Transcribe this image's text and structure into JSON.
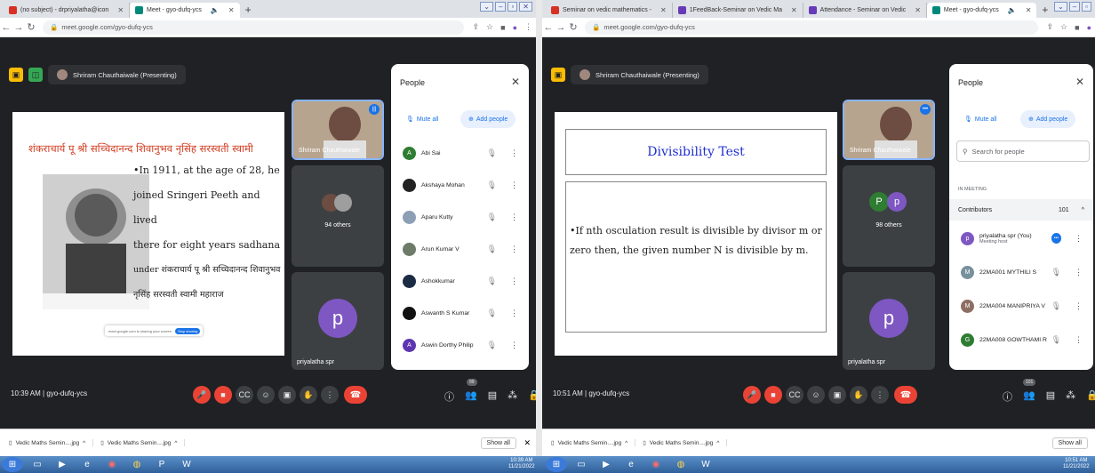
{
  "left": {
    "tabs": [
      {
        "label": "(no subject) - drpriyalatha@icon",
        "color": "#d93025"
      },
      {
        "label": "Meet - gyo-dufq-ycs",
        "color": "#00897b",
        "active": true
      }
    ],
    "url": "meet.google.com/gyo-dufq-ycs",
    "presenter": "Shriram Chauthaiwale (Presenting)",
    "slide": {
      "title": "शंकराचार्य पू श्री सच्चिदानन्द शिवानुभव नृसिंह सरस्वती स्वामी",
      "lines": [
        "•In 1911, at the age of 28, he",
        "joined Sringeri Peeth and lived",
        "there for eight years sadhana",
        "under शंकराचार्य पू श्री सच्चिदानन्द शिवानुभव",
        "नृसिंह सरस्वती स्वामी महाराज"
      ],
      "photo_bar": "meet.google.com is sharing your screen"
    },
    "tiles": {
      "speaker": "Shriram Chauthaiwale",
      "others": "94 others",
      "me": "priyalatha spr",
      "me_initial": "p"
    },
    "panel": {
      "title": "People",
      "mute_all": "Mute all",
      "add_people": "Add people",
      "people": [
        {
          "name": "Abi Sai",
          "initial": "A",
          "color": "#2e7d32"
        },
        {
          "name": "Akshaya Mohan",
          "initial": "",
          "color": "#222222"
        },
        {
          "name": "Aparu Kutty",
          "initial": "",
          "color": "#8d9fb5"
        },
        {
          "name": "Arun Kumar V",
          "initial": "",
          "color": "#6d7b68"
        },
        {
          "name": "Ashokkumar",
          "initial": "",
          "color": "#1c2b44"
        },
        {
          "name": "Aswanth S Kumar",
          "initial": "",
          "color": "#111111"
        },
        {
          "name": "Aswin Dorthy Philip",
          "initial": "A",
          "color": "#5e35b1"
        }
      ]
    },
    "time_code": "10:39 AM | gyo-dufq-ycs",
    "participant_count": "99",
    "downloads": [
      "Vedic Maths Semin....jpg",
      "Vedic Maths Semin....jpg"
    ],
    "show_all": "Show all",
    "clock": [
      "10:39 AM",
      "11/21/2022"
    ]
  },
  "right": {
    "tabs": [
      {
        "label": "Seminar on vedic mathematics -",
        "color": "#d93025"
      },
      {
        "label": "1FeedBack-Seminar on Vedic Ma",
        "color": "#673ab7"
      },
      {
        "label": "Attendance - Seminar on Vedic",
        "color": "#673ab7"
      },
      {
        "label": "Meet - gyo-dufq-ycs",
        "color": "#00897b",
        "active": true
      }
    ],
    "url": "meet.google.com/gyo-dufq-ycs",
    "presenter": "Shriram Chauthaiwale (Presenting)",
    "slide": {
      "title": "Divisibility Test",
      "body": "•If nth osculation result is divisible by divisor m or zero then, the given number N is divisible by m."
    },
    "tiles": {
      "speaker": "Shriram Chauthaiwale",
      "others": "98 others",
      "me": "priyalatha spr",
      "me_initial": "p"
    },
    "panel": {
      "title": "People",
      "mute_all": "Mute all",
      "add_people": "Add people",
      "search_placeholder": "Search for people",
      "in_meeting": "IN MEETING",
      "contributors": "Contributors",
      "count": "101",
      "people": [
        {
          "name": "priyalatha spr (You)",
          "sub": "Meeting host",
          "initial": "p",
          "color": "#7e57c2"
        },
        {
          "name": "22MA001 MYTHILI S",
          "initial": "M",
          "color": "#78909c"
        },
        {
          "name": "22MA004 MANIPRIYA V",
          "initial": "M",
          "color": "#8d6e63"
        },
        {
          "name": "22MA008 GOWTHAMI R",
          "initial": "G",
          "color": "#2e7d32"
        }
      ]
    },
    "time_code": "10:51 AM | gyo-dufq-ycs",
    "participant_count": "101",
    "downloads": [
      "Vedic Maths Semin....jpg",
      "Vedic Maths Semin....jpg"
    ],
    "show_all": "Show all",
    "clock": [
      "10:51 AM",
      "11/21/2022"
    ]
  }
}
